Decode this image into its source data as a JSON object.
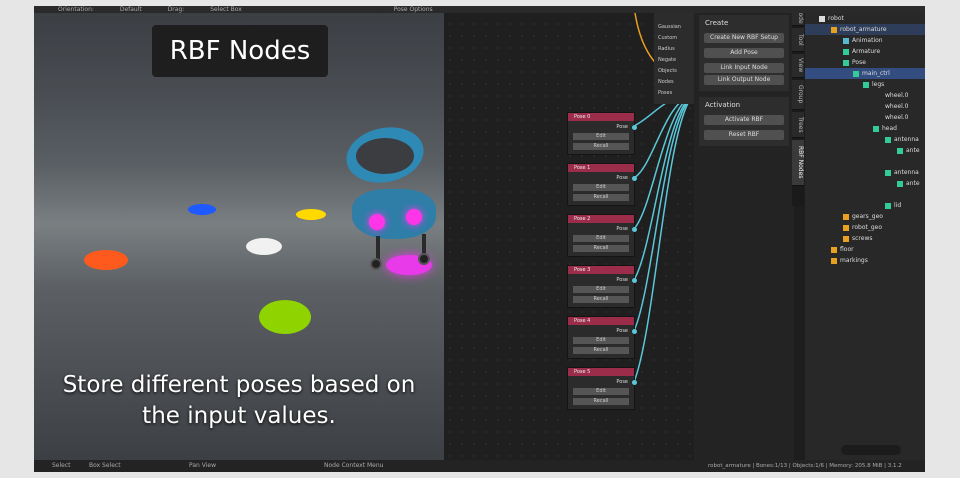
{
  "topbar": {
    "items": [
      "Orientation:",
      "Default",
      "Drag:",
      "Select Box",
      "Pose Options"
    ]
  },
  "viewport": {
    "title": "RBF Nodes",
    "caption_line1": "Store different poses based on",
    "caption_line2": "the input values.",
    "disc_colors": [
      "#ff5a1e",
      "#1e5aff",
      "#f1f1f1",
      "#ffd900",
      "#8fd400",
      "#e83ae8"
    ]
  },
  "sidepanel": {
    "items": [
      "Gaussian",
      "Custom",
      "Radius",
      "Negate",
      "Objects",
      "Nodes",
      "Poses"
    ]
  },
  "nodes": [
    {
      "title": "Pose 0",
      "out": "Pose",
      "edit": "Edit",
      "recall": "Recall"
    },
    {
      "title": "Pose 1",
      "out": "Pose",
      "edit": "Edit",
      "recall": "Recall"
    },
    {
      "title": "Pose 2",
      "out": "Pose",
      "edit": "Edit",
      "recall": "Recall"
    },
    {
      "title": "Pose 3",
      "out": "Pose",
      "edit": "Edit",
      "recall": "Recall"
    },
    {
      "title": "Pose 4",
      "out": "Pose",
      "edit": "Edit",
      "recall": "Recall"
    },
    {
      "title": "Pose 5",
      "out": "Pose",
      "edit": "Edit",
      "recall": "Recall"
    }
  ],
  "rbf_panel": {
    "header": "RBF",
    "create_title": "Create",
    "create_buttons": [
      "Create New RBF Setup",
      "Add Pose",
      "Link Input Node",
      "Link Output Node"
    ],
    "activation_title": "Activation",
    "activation_buttons": [
      "Activate RBF",
      "Reset RBF"
    ]
  },
  "tabs": [
    "Node",
    "Tool",
    "View",
    "Group",
    "Trees",
    "RBF Nodes"
  ],
  "outliner": {
    "header": "Scene Collection",
    "rows": [
      {
        "label": "robot"
      },
      {
        "label": "robot_armature"
      },
      {
        "label": "Animation"
      },
      {
        "label": "Armature"
      },
      {
        "label": "Pose"
      },
      {
        "label": "main_ctrl"
      },
      {
        "label": "legs"
      },
      {
        "label": "wheel.0"
      },
      {
        "label": "wheel.0"
      },
      {
        "label": "wheel.0"
      },
      {
        "label": "head"
      },
      {
        "label": "antenna"
      },
      {
        "label": "ante"
      },
      {
        "label": "antenna"
      },
      {
        "label": "ante"
      },
      {
        "label": "lid"
      },
      {
        "label": "gears_geo"
      },
      {
        "label": "robot_geo"
      },
      {
        "label": "screws"
      },
      {
        "label": "floor"
      },
      {
        "label": "markings"
      }
    ]
  },
  "statusbar": {
    "select": "Select",
    "box_select": "Box Select",
    "pan_view": "Pan View",
    "context_menu": "Node Context Menu",
    "info": "robot_armature | Bones:1/13 | Objects:1/6 | Memory: 205.8 MiB | 3.1.2"
  }
}
